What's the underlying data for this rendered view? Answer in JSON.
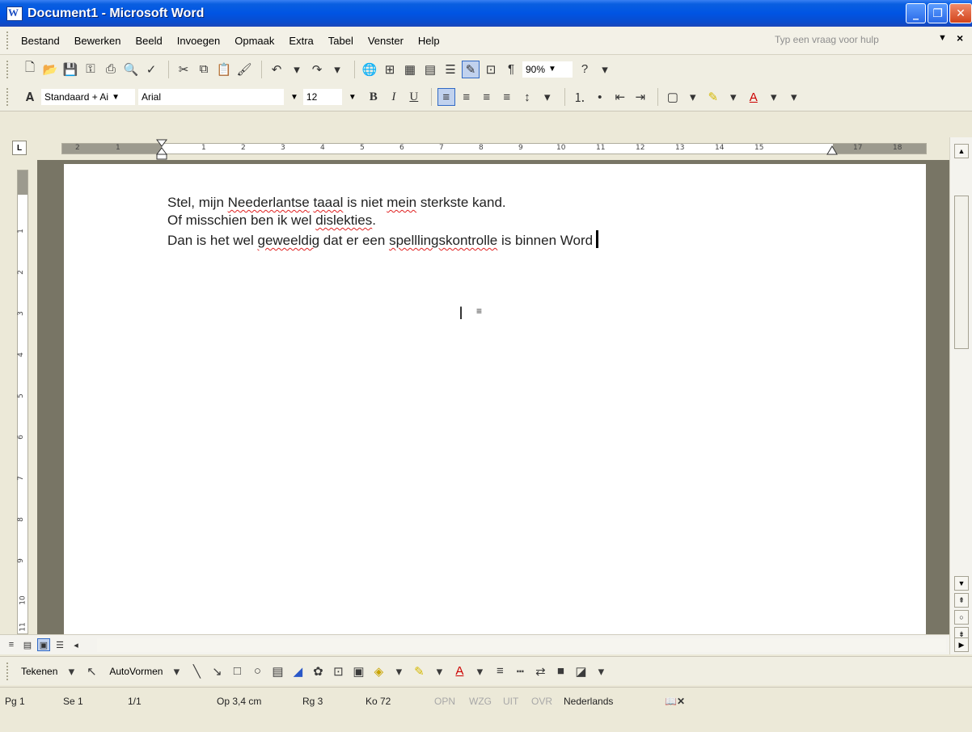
{
  "window": {
    "title": "Document1 - Microsoft Word",
    "controls": {
      "minimize": "_",
      "restore": "❐",
      "close": "✕"
    }
  },
  "menu": {
    "items": [
      "Bestand",
      "Bewerken",
      "Beeld",
      "Invoegen",
      "Opmaak",
      "Extra",
      "Tabel",
      "Venster",
      "Help"
    ],
    "help_placeholder": "Typ een vraag voor hulp"
  },
  "toolbar": {
    "zoom": "90%",
    "style": "Standaard + Ai",
    "font": "Arial",
    "size": "12"
  },
  "ruler": {
    "numbers": [
      "2",
      "1",
      "1",
      "2",
      "3",
      "4",
      "5",
      "6",
      "7",
      "8",
      "9",
      "10",
      "11",
      "12",
      "13",
      "14",
      "15",
      "17",
      "18"
    ],
    "vnumbers": [
      "1",
      "2",
      "3",
      "4",
      "5",
      "6",
      "7",
      "8",
      "9",
      "10",
      "11"
    ]
  },
  "document": {
    "line1": {
      "a": "Stel, mijn ",
      "w1": "Neederlantse",
      "b": " ",
      "w2": "taaal",
      "c": " is niet ",
      "w3": "mein",
      "d": " sterkste kand."
    },
    "line2": {
      "a": "Of misschien ben ik wel ",
      "w1": "dislekties",
      "b": "."
    },
    "line3": {
      "a": "Dan is het wel ",
      "w1": "geweeldig",
      "b": " dat er een ",
      "w2": "spelllingskontrolle",
      "c": " is binnen Word"
    }
  },
  "drawbar": {
    "draw": "Tekenen",
    "autoshapes": "AutoVormen"
  },
  "status": {
    "page": "Pg 1",
    "section": "Se 1",
    "pages": "1/1",
    "at": "Op 3,4 cm",
    "line": "Rg 3",
    "col": "Ko 72",
    "rec": "OPN",
    "trk": "WZG",
    "ext": "UIT",
    "ovr": "OVR",
    "language": "Nederlands"
  },
  "colors": {
    "titlebar": "#0054e3",
    "spell_error": "#e02020",
    "doc_background": "#787565"
  }
}
